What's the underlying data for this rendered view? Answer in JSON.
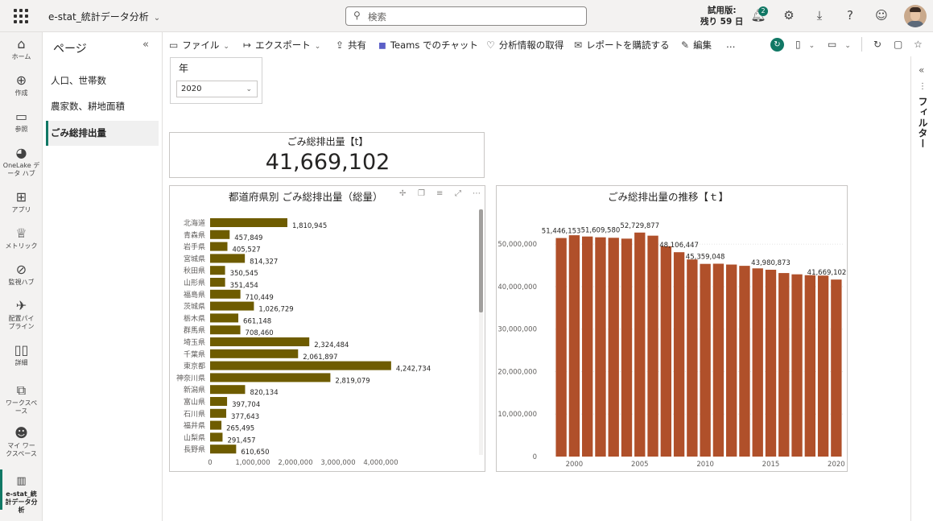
{
  "app": {
    "title": "e-stat_統計データ分析",
    "search_placeholder": "検索",
    "trial_label": "試用版:",
    "trial_days": "残り 59 日",
    "notification_count": "2"
  },
  "nav": {
    "items": [
      {
        "label": "ホーム",
        "icon": "home-icon"
      },
      {
        "label": "作成",
        "icon": "plus-circle-icon"
      },
      {
        "label": "参照",
        "icon": "folder-icon"
      },
      {
        "label": "OneLake データ ハブ",
        "icon": "onelake-icon"
      },
      {
        "label": "アプリ",
        "icon": "apps-icon"
      },
      {
        "label": "メトリック",
        "icon": "trophy-icon"
      },
      {
        "label": "監視ハブ",
        "icon": "monitor-icon"
      },
      {
        "label": "配置パイプライン",
        "icon": "rocket-icon"
      },
      {
        "label": "詳細",
        "icon": "book-icon"
      },
      {
        "label": "ワークスペース",
        "icon": "workspaces-icon"
      },
      {
        "label": "マイ ワークスペース",
        "icon": "avatar-icon"
      },
      {
        "label": "e-stat_統計データ分析",
        "icon": "report-icon"
      }
    ]
  },
  "pages": {
    "title": "ページ",
    "items": [
      "人口、世帯数",
      "農家数、耕地面積",
      "ごみ総排出量"
    ],
    "active_index": 2
  },
  "commands": {
    "file": "ファイル",
    "export": "エクスポート",
    "share": "共有",
    "teams": "Teams でのチャット",
    "insights": "分析情報の取得",
    "subscribe": "レポートを購読する",
    "edit": "編集",
    "more": "…"
  },
  "filters_label": "フィルター",
  "slicer": {
    "label": "年",
    "selected": "2020"
  },
  "card": {
    "title": "ごみ総排出量【t】",
    "value": "41,669,102"
  },
  "colors": {
    "bar_olive": "#6e5c00",
    "bar_rust": "#b0502a",
    "accent": "#117865"
  },
  "chart_data": [
    {
      "type": "bar",
      "orientation": "horizontal",
      "title": "都道府県別 ごみ総排出量（総量）",
      "categories": [
        "北海道",
        "青森県",
        "岩手県",
        "宮城県",
        "秋田県",
        "山形県",
        "福島県",
        "茨城県",
        "栃木県",
        "群馬県",
        "埼玉県",
        "千葉県",
        "東京都",
        "神奈川県",
        "新潟県",
        "富山県",
        "石川県",
        "福井県",
        "山梨県",
        "長野県"
      ],
      "values": [
        1810945,
        457849,
        405527,
        814327,
        350545,
        351454,
        710449,
        1026729,
        661148,
        708460,
        2324484,
        2061897,
        4242734,
        2819079,
        820134,
        397704,
        377643,
        265495,
        291457,
        610650
      ],
      "value_labels": [
        "1,810,945",
        "457,849",
        "405,527",
        "814,327",
        "350,545",
        "351,454",
        "710,449",
        "1,026,729",
        "661,148",
        "708,460",
        "2,324,484",
        "2,061,897",
        "4,242,734",
        "2,819,079",
        "820,134",
        "397,704",
        "377,643",
        "265,495",
        "291,457",
        "610,650"
      ],
      "xticks": [
        "0",
        "1,000,000",
        "2,000,000",
        "3,000,000",
        "4,000,000"
      ],
      "xlim": [
        0,
        5000000
      ]
    },
    {
      "type": "bar",
      "title": "ごみ総排出量の推移【ｔ】",
      "x": [
        1999,
        2000,
        2001,
        2002,
        2003,
        2004,
        2005,
        2006,
        2007,
        2008,
        2009,
        2010,
        2011,
        2012,
        2013,
        2014,
        2015,
        2016,
        2017,
        2018,
        2019,
        2020
      ],
      "values": [
        51446153,
        52100000,
        51800000,
        51609580,
        51500000,
        51300000,
        52729877,
        52000000,
        49500000,
        48106447,
        46400000,
        45359048,
        45400000,
        45200000,
        44900000,
        44300000,
        43980873,
        43200000,
        42900000,
        42700000,
        42600000,
        41669102
      ],
      "data_labels": [
        {
          "x": 1999,
          "text": "51,446,153"
        },
        {
          "x": 2002,
          "text": "51,609,580"
        },
        {
          "x": 2005,
          "text": "52,729,877"
        },
        {
          "x": 2008,
          "text": "48,106,447"
        },
        {
          "x": 2010,
          "text": "45,359,048"
        },
        {
          "x": 2015,
          "text": "43,980,873"
        },
        {
          "x": 2020,
          "text": "41,669,102"
        }
      ],
      "yticks": [
        "0",
        "10,000,000",
        "20,000,000",
        "30,000,000",
        "40,000,000",
        "50,000,000"
      ],
      "xticks": [
        "2000",
        "2005",
        "2010",
        "2015",
        "2020"
      ],
      "ylim": [
        0,
        58000000
      ]
    }
  ]
}
